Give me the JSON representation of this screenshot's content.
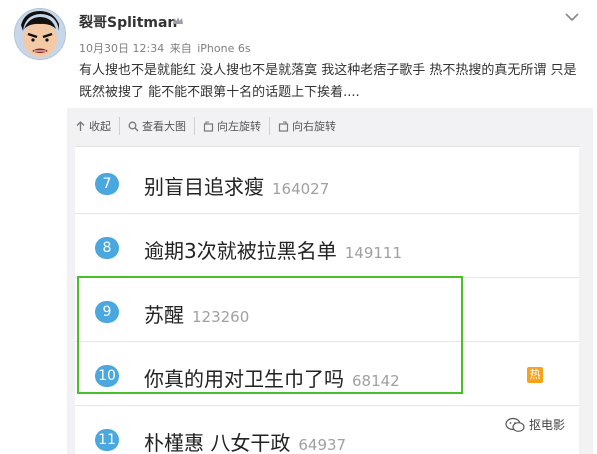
{
  "post": {
    "author": "裂哥Splitman",
    "date": "10月30日 12:34",
    "source_prefix": "来自",
    "device": "iPhone 6s",
    "text": "有人搜也不是就能红 没人搜也不是就落寞 我这种老痞子歌手 热不热搜的真无所谓 只是既然被搜了 能不能不跟第十名的话题上下挨着...."
  },
  "toolbar": {
    "items": [
      {
        "label": "收起",
        "icon": "collapse-arrow-icon"
      },
      {
        "label": "查看大图",
        "icon": "magnifier-icon"
      },
      {
        "label": "向左旋转",
        "icon": "rotate-left-icon"
      },
      {
        "label": "向右旋转",
        "icon": "rotate-right-icon"
      }
    ]
  },
  "hot_list": {
    "rows": [
      {
        "rank": "7",
        "title": "别盲目追求瘦",
        "count": "164027",
        "badge": ""
      },
      {
        "rank": "8",
        "title": "逾期3次就被拉黑名单",
        "count": "149111",
        "badge": ""
      },
      {
        "rank": "9",
        "title": "苏醒",
        "count": "123260",
        "badge": ""
      },
      {
        "rank": "10",
        "title": "你真的用对卫生巾了吗",
        "count": "68142",
        "badge": "热"
      },
      {
        "rank": "11",
        "title": "朴槿惠 八女干政",
        "count": "64937",
        "badge": ""
      }
    ]
  },
  "watermark": {
    "text": "抠电影"
  },
  "colors": {
    "rank_badge": "#4aa8de",
    "hot_badge": "#f7a21b",
    "highlight": "#49c02a",
    "panel_bg": "#f2f2f5"
  }
}
